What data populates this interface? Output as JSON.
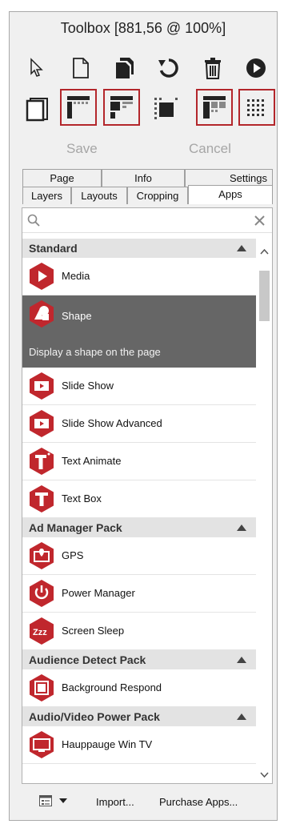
{
  "title": "Toolbox [881,56 @ 100%]",
  "toolbar": {
    "row1": [
      "pointer-icon",
      "new-page-icon",
      "copy-page-icon",
      "undo-icon",
      "delete-icon",
      "play-icon"
    ],
    "row2": [
      "page-frame-icon",
      "layout-corner-icon",
      "layout-split-icon",
      "layout-center-icon",
      "layout-grid-icon",
      "layout-dots-icon"
    ],
    "save_label": "Save",
    "cancel_label": "Cancel"
  },
  "tabs_top": [
    "Page",
    "Info",
    "Settings"
  ],
  "tabs_bottom": [
    "Layers",
    "Layouts",
    "Cropping",
    "Apps"
  ],
  "active_tab": "Apps",
  "search": {
    "placeholder": "",
    "value": ""
  },
  "sections": [
    {
      "title": "Standard"
    },
    {
      "title": "Ad Manager Pack"
    },
    {
      "title": "Audience Detect Pack"
    },
    {
      "title": "Audio/Video Power Pack"
    }
  ],
  "items": {
    "media": "Media",
    "shape": "Shape",
    "shape_desc": "Display a shape on the page",
    "slide_show": "Slide Show",
    "slide_show_adv": "Slide Show Advanced",
    "text_animate": "Text Animate",
    "text_box": "Text Box",
    "gps": "GPS",
    "power_manager": "Power Manager",
    "screen_sleep": "Screen Sleep",
    "background_respond": "Background Respond",
    "hauppauge": "Hauppauge Win TV"
  },
  "bottom": {
    "import_label": "Import...",
    "purchase_label": "Purchase Apps..."
  },
  "colors": {
    "accent": "#c0272d",
    "selected_bg": "#666666",
    "section_bg": "#e3e3e3"
  }
}
